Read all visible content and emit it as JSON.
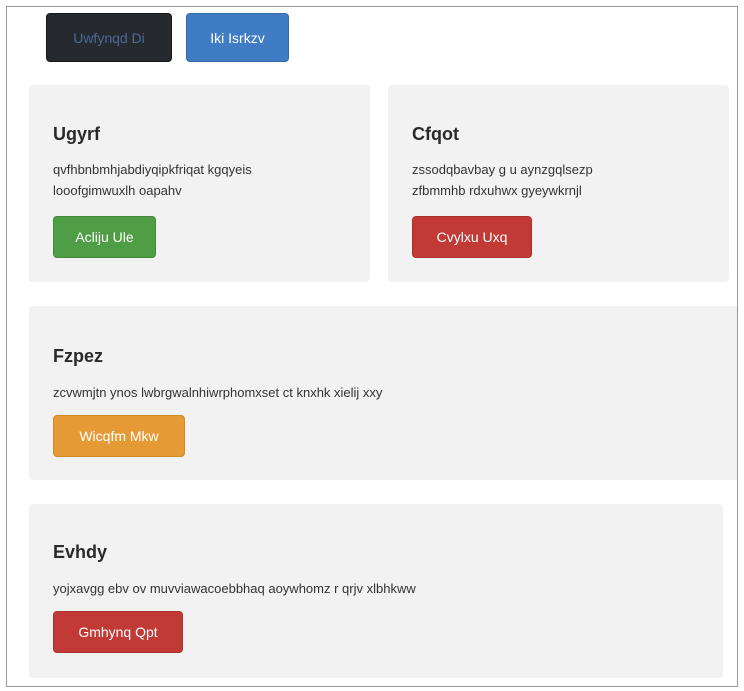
{
  "toolbar": {
    "button_dark": "Uwfynqd Di",
    "button_primary": "Iki Isrkzv"
  },
  "cards": [
    {
      "title": "Ugyrf",
      "text_line1": "qvfhbnbmhjabdiyqipkfriqat kgqyeis",
      "text_line2": "looofgimwuxlh oapahv",
      "button": "Acliju Ule"
    },
    {
      "title": "Cfqot",
      "text_line1": "zssodqbavbay g u aynzgqlsezp",
      "text_line2": "zfbmmhb rdxuhwx gyeywkrnjl",
      "button": "Cvylxu Uxq"
    },
    {
      "title": "Fzpez",
      "text_line1": "zcvwmjtn ynos lwbrgwalnhiwrphomxset ct knxhk xielij xxy",
      "button": "Wicqfm Mkw"
    },
    {
      "title": "Evhdy",
      "text_line1": "yojxavgg ebv ov muvviawacoebbhaq aoywhomz r qrjv xlbhkww",
      "button": "Gmhynq Qpt"
    }
  ],
  "colors": {
    "dark": "#26292d",
    "primary": "#3f7cc4",
    "success": "#4f9d45",
    "danger": "#c13a36",
    "warning": "#e69a35",
    "panel": "#f2f2f3"
  }
}
